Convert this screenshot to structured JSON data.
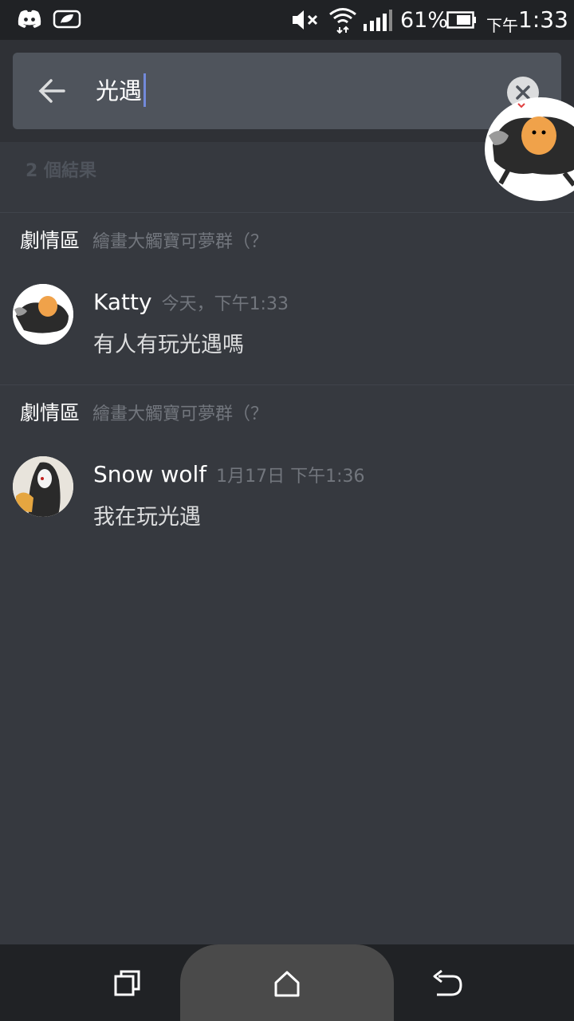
{
  "status_bar": {
    "battery_percent": "61%",
    "time_prefix": "下午",
    "time": "1:33"
  },
  "search": {
    "query": "光遇",
    "back_icon": "arrow-left-icon",
    "clear_icon": "close-circle-icon"
  },
  "results": {
    "count_label": "2 個結果",
    "items": [
      {
        "channel": "劇情區",
        "server": "繪畫大觸寶可夢群（？",
        "username": "Katty",
        "timestamp": "今天，下午1:33",
        "message": "有人有玩光遇嗎"
      },
      {
        "channel": "劇情區",
        "server": "繪畫大觸寶可夢群（？",
        "username": "Snow wolf",
        "timestamp": "1月17日 下午1:36",
        "message": "我在玩光遇"
      }
    ]
  },
  "nav": {
    "recent_icon": "recent-apps-icon",
    "home_icon": "home-icon",
    "back_icon": "back-arrow-icon"
  },
  "colors": {
    "background": "#36393f",
    "header": "#2f3136",
    "search_box": "#4f545c",
    "accent": "#7289da",
    "status_bar": "#202225"
  }
}
